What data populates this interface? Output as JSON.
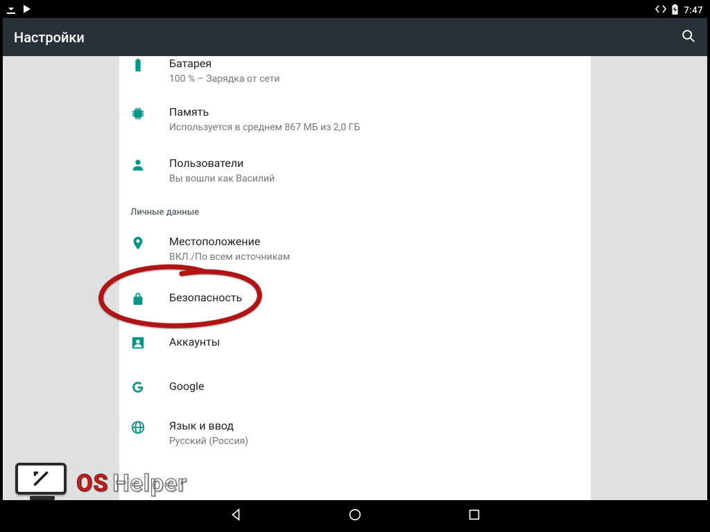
{
  "status": {
    "time": "7:47"
  },
  "appbar": {
    "title": "Настройки"
  },
  "sections": {
    "personal_header": "Личные данные"
  },
  "items": {
    "battery": {
      "title": "Батарея",
      "sub": "100 % – Зарядка от сети"
    },
    "memory": {
      "title": "Память",
      "sub": "Используется в среднем 867 МБ из 2,0 ГБ"
    },
    "users": {
      "title": "Пользователи",
      "sub": "Вы вошли как Василий"
    },
    "location": {
      "title": "Местоположение",
      "sub": "ВКЛ./По всем источникам"
    },
    "security": {
      "title": "Безопасность"
    },
    "accounts": {
      "title": "Аккаунты"
    },
    "google": {
      "title": "Google"
    },
    "language": {
      "title": "Язык и ввод",
      "sub": "Русский (Россия)"
    }
  },
  "watermark": {
    "os": "OS",
    "helper": "Helper"
  }
}
